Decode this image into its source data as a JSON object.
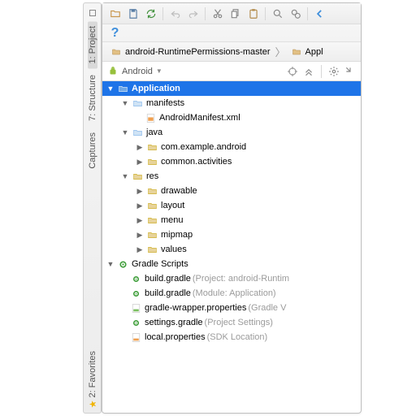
{
  "sidebar": {
    "tabs": [
      {
        "label": "1: Project"
      },
      {
        "label": "7: Structure"
      },
      {
        "label": "Captures"
      }
    ],
    "bottom_tab": {
      "label": "2: Favorites"
    }
  },
  "breadcrumb": {
    "seg1": "android-RuntimePermissions-master",
    "seg2": "Appl"
  },
  "view_header": {
    "selector": "Android"
  },
  "help_glyph": "?",
  "tree": {
    "application": "Application",
    "manifests": "manifests",
    "manifest_xml": "AndroidManifest.xml",
    "java": "java",
    "pkg1": "com.example.android",
    "pkg2": "common.activities",
    "res": "res",
    "drawable": "drawable",
    "layout": "layout",
    "menu": "menu",
    "mipmap": "mipmap",
    "values": "values",
    "gradle_scripts": "Gradle Scripts",
    "bg1_name": "build.gradle",
    "bg1_hint": " (Project: android-Runtim",
    "bg2_name": "build.gradle",
    "bg2_hint": " (Module: Application)",
    "gwp_name": "gradle-wrapper.properties",
    "gwp_hint": " (Gradle V",
    "sg_name": "settings.gradle",
    "sg_hint": " (Project Settings)",
    "lp_name": "local.properties",
    "lp_hint": " (SDK Location)"
  }
}
